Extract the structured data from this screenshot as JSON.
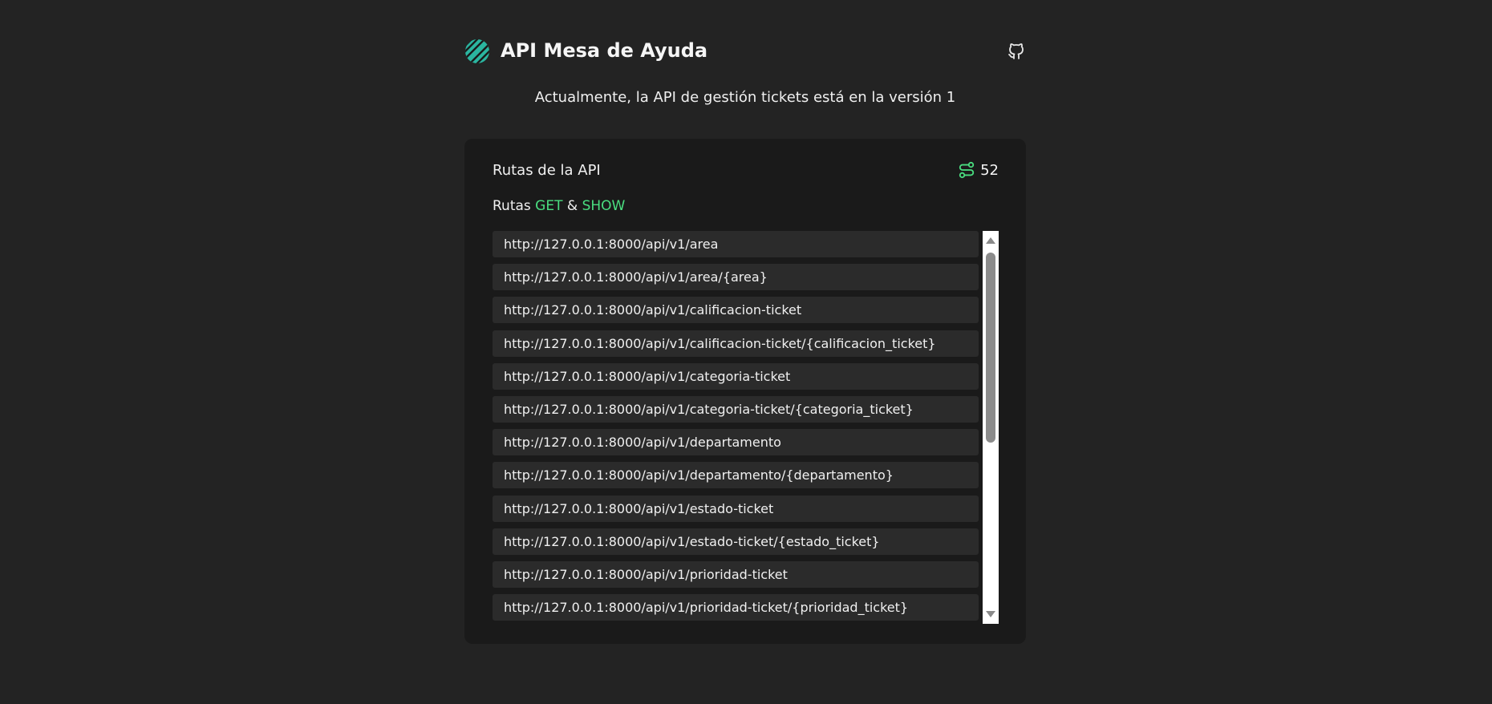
{
  "header": {
    "title": "API Mesa de Ayuda",
    "logo_icon": "striped-circle-logo",
    "github_icon": "github-icon"
  },
  "subtitle": "Actualmente, la API de gestión tickets está en la versión 1",
  "card": {
    "title": "Rutas de la API",
    "route_count": "52",
    "rutas_label": "Rutas",
    "method_get": "GET",
    "ampersand": "&",
    "method_show": "SHOW",
    "routes": [
      "http://127.0.0.1:8000/api/v1/area",
      "http://127.0.0.1:8000/api/v1/area/{area}",
      "http://127.0.0.1:8000/api/v1/calificacion-ticket",
      "http://127.0.0.1:8000/api/v1/calificacion-ticket/{calificacion_ticket}",
      "http://127.0.0.1:8000/api/v1/categoria-ticket",
      "http://127.0.0.1:8000/api/v1/categoria-ticket/{categoria_ticket}",
      "http://127.0.0.1:8000/api/v1/departamento",
      "http://127.0.0.1:8000/api/v1/departamento/{departamento}",
      "http://127.0.0.1:8000/api/v1/estado-ticket",
      "http://127.0.0.1:8000/api/v1/estado-ticket/{estado_ticket}",
      "http://127.0.0.1:8000/api/v1/prioridad-ticket",
      "http://127.0.0.1:8000/api/v1/prioridad-ticket/{prioridad_ticket}"
    ]
  },
  "colors": {
    "background": "#232323",
    "card": "#1a1a1a",
    "item": "#2b2b2b",
    "accent_green": "#4ade80",
    "logo_teal": "#2bb5a0"
  }
}
